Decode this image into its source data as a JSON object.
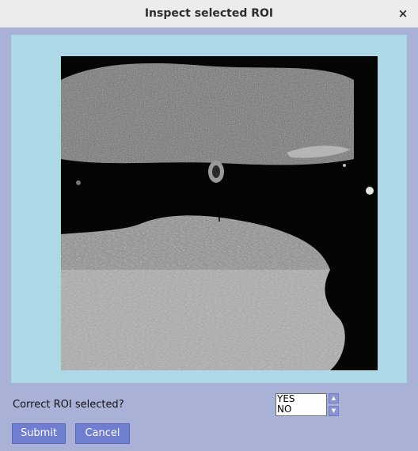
{
  "window": {
    "title": "Inspect selected ROI",
    "close_glyph": "×"
  },
  "image": {
    "description_icon": "roi-image"
  },
  "form": {
    "question": "Correct ROI selected?",
    "options": [
      "YES",
      "NO"
    ],
    "spin_up_glyph": "▲",
    "spin_down_glyph": "▼"
  },
  "buttons": {
    "submit": "Submit",
    "cancel": "Cancel"
  },
  "colors": {
    "background": "#a9b1d6",
    "panel": "#add8e6",
    "button": "#6f7ed0"
  }
}
